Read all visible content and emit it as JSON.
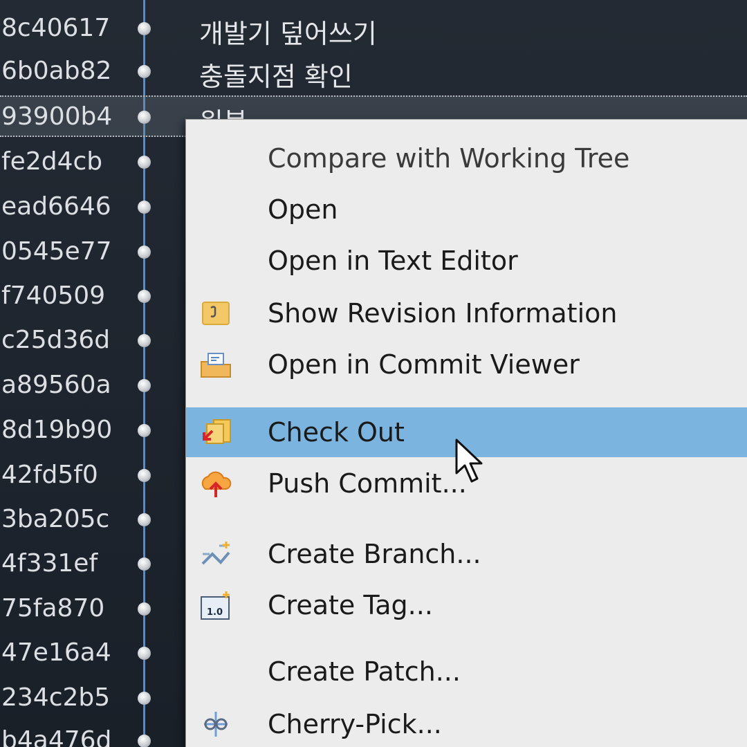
{
  "history": {
    "commits": [
      {
        "hash": "8c40617",
        "message": "개발기 덮어쓰기"
      },
      {
        "hash": "6b0ab82",
        "message": "충돌지점 확인"
      },
      {
        "hash": "93900b4",
        "message": "원복"
      },
      {
        "hash": "fe2d4cb",
        "message": ""
      },
      {
        "hash": "ead6646",
        "message": ""
      },
      {
        "hash": "0545e77",
        "message": ""
      },
      {
        "hash": "f740509",
        "message": ""
      },
      {
        "hash": "c25d36d",
        "message": ""
      },
      {
        "hash": "a89560a",
        "message": ""
      },
      {
        "hash": "8d19b90",
        "message": ""
      },
      {
        "hash": "42fd5f0",
        "message": ""
      },
      {
        "hash": "3ba205c",
        "message": ""
      },
      {
        "hash": "4f331ef",
        "message": ""
      },
      {
        "hash": "75fa870",
        "message": ""
      },
      {
        "hash": "47e16a4",
        "message": ""
      },
      {
        "hash": "234c2b5",
        "message": ""
      },
      {
        "hash": "b4a476d",
        "message": ""
      }
    ]
  },
  "context_menu": {
    "items": [
      {
        "label": "Compare with Working Tree",
        "icon": "none"
      },
      {
        "label": "Open",
        "icon": "none"
      },
      {
        "label": "Open in Text Editor",
        "icon": "none"
      },
      {
        "label": "Show Revision Information",
        "icon": "revision-info-icon"
      },
      {
        "label": "Open in Commit Viewer",
        "icon": "commit-viewer-icon"
      },
      {
        "label": "Check Out",
        "icon": "checkout-icon"
      },
      {
        "label": "Push Commit...",
        "icon": "push-icon"
      },
      {
        "label": "Create Branch...",
        "icon": "branch-icon"
      },
      {
        "label": "Create Tag...",
        "icon": "tag-icon"
      },
      {
        "label": "Create Patch...",
        "icon": "none"
      },
      {
        "label": "Cherry-Pick...",
        "icon": "cherry-pick-icon"
      }
    ],
    "tag_icon_text": "1.0"
  },
  "colors": {
    "highlight": "#7cb4e0",
    "graph_line": "#4c8fd6",
    "menu_bg": "#ececec",
    "panel_bg": "#1e242d"
  }
}
